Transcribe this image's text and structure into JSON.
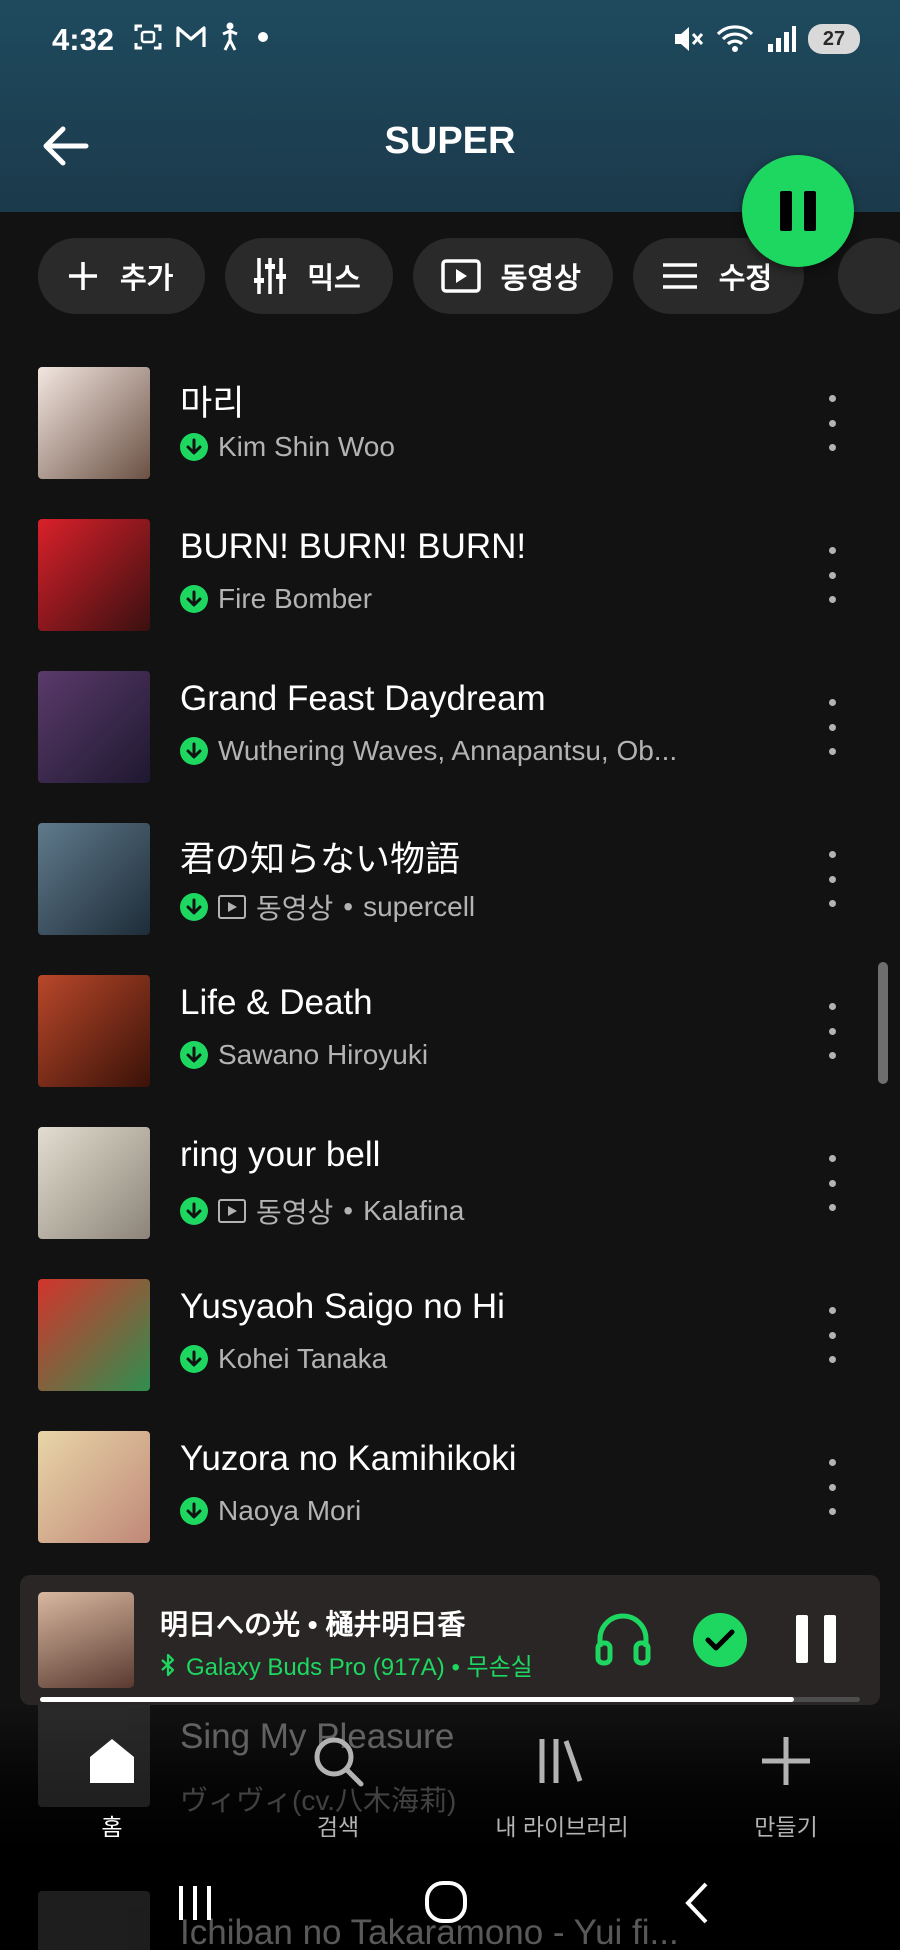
{
  "status_bar": {
    "time": "4:32",
    "left_icons": [
      "screenshot-icon",
      "gmail-icon",
      "accessibility-icon",
      "dot-icon"
    ],
    "right_icons": [
      "mute-icon",
      "wifi-icon",
      "signal-icon"
    ],
    "battery": "27"
  },
  "header": {
    "title": "SUPER",
    "back_icon": "arrow-left-icon",
    "background": "#1d4253"
  },
  "play_button": {
    "state": "playing",
    "icon": "pause-icon",
    "color": "#1ed760"
  },
  "chips": [
    {
      "label": "추가",
      "icon": "plus-icon"
    },
    {
      "label": "믹스",
      "icon": "mixer-icon"
    },
    {
      "label": "동영상",
      "icon": "video-icon"
    },
    {
      "label": "수정",
      "icon": "menu-icon"
    }
  ],
  "tracks": [
    {
      "title": "마리",
      "artist": "Kim Shin Woo",
      "video": false,
      "cover_colors": [
        "#f2e6e0",
        "#6b5144"
      ]
    },
    {
      "title": "BURN! BURN! BURN!",
      "artist": "Fire Bomber",
      "video": false,
      "cover_colors": [
        "#d9202a",
        "#3a1010"
      ]
    },
    {
      "title": "Grand Feast Daydream",
      "artist": "Wuthering Waves, Annapantsu, Ob...",
      "video": false,
      "cover_colors": [
        "#5a3a6a",
        "#1e1830"
      ]
    },
    {
      "title": "君の知らない物語",
      "artist": "supercell",
      "video": true,
      "video_label": "동영상",
      "cover_colors": [
        "#5f7a8c",
        "#1e2c38"
      ]
    },
    {
      "title": "Life & Death",
      "artist": "Sawano Hiroyuki",
      "video": false,
      "cover_colors": [
        "#b8472a",
        "#3a1208"
      ]
    },
    {
      "title": "ring your bell",
      "artist": "Kalafina",
      "video": true,
      "video_label": "동영상",
      "cover_colors": [
        "#e2ddd0",
        "#8c8478"
      ]
    },
    {
      "title": "Yusyaoh Saigo no Hi",
      "artist": "Kohei Tanaka",
      "video": false,
      "cover_colors": [
        "#d3342c",
        "#2f8f4f"
      ]
    },
    {
      "title": "Yuzora no Kamihikoki",
      "artist": "Naoya Mori",
      "video": false,
      "cover_colors": [
        "#e8d5a8",
        "#c08878"
      ]
    }
  ],
  "ghost_tracks": [
    {
      "title": "Sing My Pleasure",
      "artist": "ヴィヴィ(cv.八木海莉)"
    },
    {
      "title": "Ichiban no Takaramono - Yui fi..."
    }
  ],
  "mini_player": {
    "title": "明日への光 • 樋井明日香",
    "device": "Galaxy Buds Pro (917A) • 무손실",
    "device_icon": "bluetooth-icon",
    "progress": 0.92,
    "cover_colors": [
      "#d8b8a0",
      "#5a3a30"
    ]
  },
  "bottom_nav": [
    {
      "label": "홈",
      "icon": "home-icon",
      "active": true
    },
    {
      "label": "검색",
      "icon": "search-icon",
      "active": false
    },
    {
      "label": "내 라이브러리",
      "icon": "library-icon",
      "active": false
    },
    {
      "label": "만들기",
      "icon": "plus-icon",
      "active": false
    }
  ],
  "system_nav": [
    "recents-icon",
    "home-circle-icon",
    "back-chevron-icon"
  ],
  "colors": {
    "accent": "#1ed760",
    "background": "#121212",
    "secondary_text": "#b3b3b3"
  }
}
